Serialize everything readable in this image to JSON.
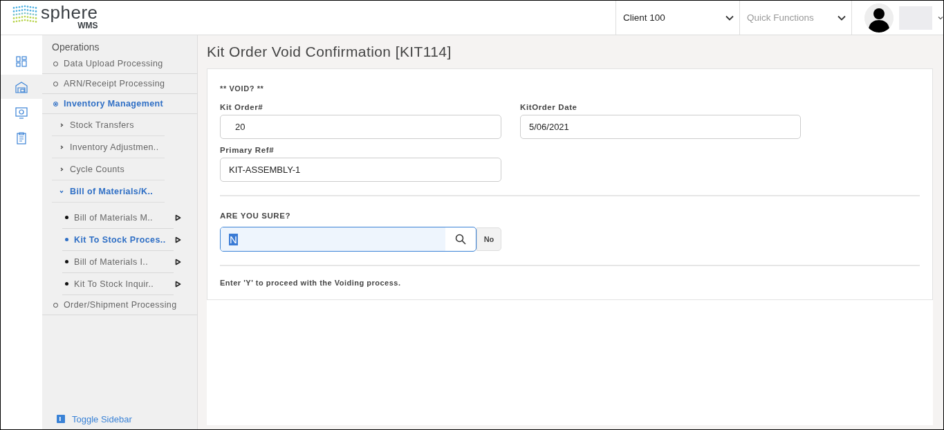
{
  "header": {
    "logo": {
      "name": "sphere",
      "sub": "WMS"
    },
    "client_select": {
      "value": "Client 100"
    },
    "quick_functions": {
      "placeholder": "Quick Functions"
    }
  },
  "nav_rail": [
    {
      "kind": "dashboard",
      "selected": false
    },
    {
      "kind": "warehouse",
      "selected": true
    },
    {
      "kind": "monitor",
      "selected": false
    },
    {
      "kind": "clipboard",
      "selected": false
    }
  ],
  "sidebar": {
    "heading": "Operations",
    "items": [
      {
        "label": "Data Upload Processing",
        "selected": false
      },
      {
        "label": "ARN/Receipt Processing",
        "selected": false
      },
      {
        "label": "Inventory Management",
        "selected": true,
        "children": [
          {
            "label": "Stock Transfers",
            "selected": false,
            "expanded": false
          },
          {
            "label": "Inventory Adjustmen..",
            "selected": false,
            "expanded": false
          },
          {
            "label": "Cycle Counts",
            "selected": false,
            "expanded": false
          },
          {
            "label": "Bill of Materials/K..",
            "selected": true,
            "expanded": true,
            "children": [
              {
                "label": "Bill of Materials M..",
                "selected": false
              },
              {
                "label": "Kit To Stock Proces..",
                "selected": true
              },
              {
                "label": "Bill of Materials I..",
                "selected": false
              },
              {
                "label": "Kit To Stock Inquir..",
                "selected": false
              }
            ]
          }
        ]
      },
      {
        "label": "Order/Shipment Processing",
        "selected": false
      }
    ],
    "toggle": "Toggle Sidebar"
  },
  "page": {
    "title": "Kit Order Void Confirmation [KIT114]",
    "section": "** VOID? **",
    "fields": [
      {
        "label": "Kit Order#",
        "value": "20"
      },
      {
        "label": "KitOrder Date",
        "value": "5/06/2021"
      },
      {
        "label": "Primary Ref#",
        "value": "KIT-ASSEMBLY-1"
      }
    ],
    "prompt": {
      "label": "ARE YOU SURE?",
      "value": "N",
      "meaning": "No"
    },
    "hint": "Enter 'Y' to proceed with the Voiding process."
  }
}
